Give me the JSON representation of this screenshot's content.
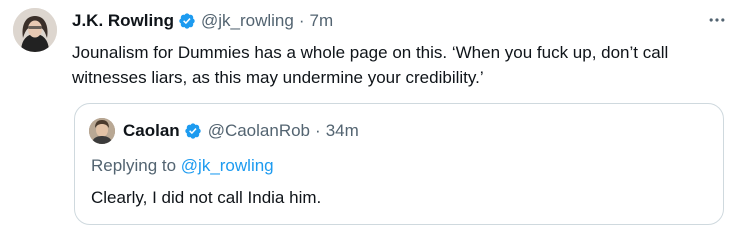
{
  "tweet": {
    "display_name": "J.K. Rowling",
    "handle": "@jk_rowling",
    "separator": "·",
    "time": "7m",
    "text": "Jounalism for Dummies has a whole page on this. ‘When you fuck up, don’t call witnesses liars, as this may undermine your credibility.’"
  },
  "quote": {
    "display_name": "Caolan",
    "handle": "@CaolanRob",
    "separator": "·",
    "time": "34m",
    "replying_prefix": "Replying to ",
    "replying_to": "@jk_rowling",
    "text": "Clearly, I did not call India him."
  },
  "icons": {
    "verified": "verified-badge-icon",
    "more": "more-horizontal-icon"
  },
  "colors": {
    "primary_text": "#0f1419",
    "secondary_text": "#536471",
    "accent": "#1d9bf0",
    "border": "#cfd9de"
  }
}
